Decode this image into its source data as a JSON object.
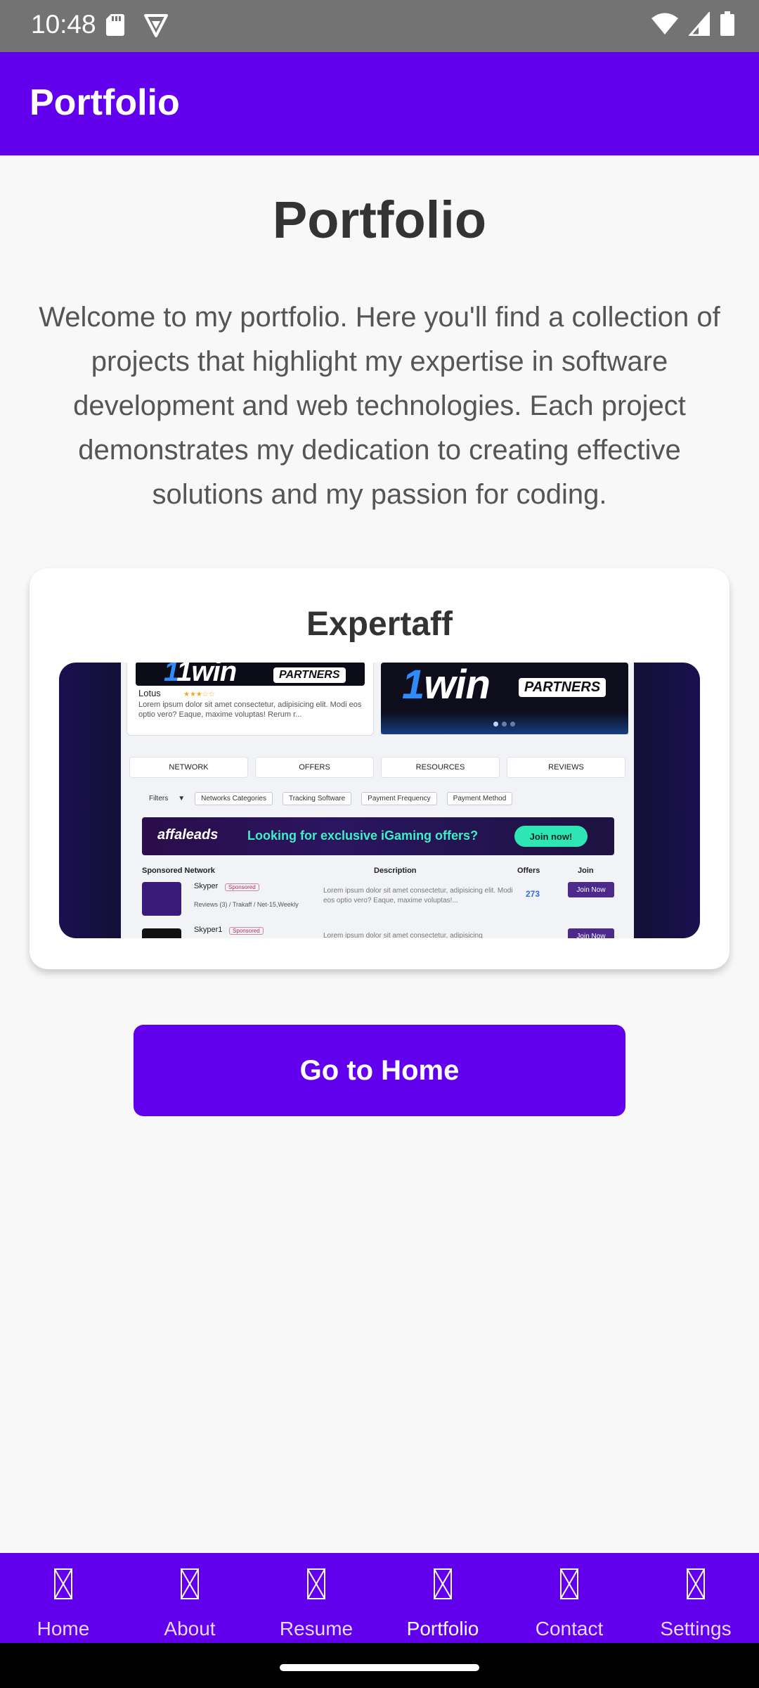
{
  "status_bar": {
    "time": "10:48",
    "icons_left": [
      "sd-card-icon",
      "vpn-shield-icon"
    ],
    "icons_right": [
      "wifi-icon",
      "signal-icon",
      "battery-icon"
    ]
  },
  "app_bar": {
    "title": "Portfolio"
  },
  "main": {
    "title": "Portfolio",
    "intro": "Welcome to my portfolio. Here you'll find a collection of projects that highlight my expertise in software development and web technologies. Each project demonstrates my dedication to creating effective solutions and my passion for coding."
  },
  "project_card": {
    "title": "Expertaff",
    "screenshot": {
      "top_left_name": "Lotus",
      "lorem": "Lorem ipsum dolor sit amet consectetur, adipisicing elit. Modi eos optio vero? Eaque, maxime voluptas! Rerum r...",
      "logo_text": "1win",
      "partners": "PARTNERS",
      "tabs": [
        "NETWORK",
        "OFFERS",
        "RESOURCES",
        "REVIEWS"
      ],
      "filters_label": "Filters",
      "filters": [
        "Networks Categories",
        "Tracking Software",
        "Payment Frequency",
        "Payment Method"
      ],
      "promo_brand": "affaleads",
      "promo_message": "Looking for exclusive iGaming offers?",
      "promo_cta": "Join now!",
      "table_headers": [
        "Sponsored Network",
        "Description",
        "Offers",
        "Join"
      ],
      "rows": [
        {
          "name": "Skyper",
          "badge": "Sponsored",
          "meta": "Reviews (3) / Trakaff / Net-15,Weekly",
          "desc": "Lorem ipsum dolor sit amet consectetur, adipisicing elit. Modi eos optio vero? Eaque, maxime voluptas!...",
          "offers": "273",
          "join": "Join Now"
        },
        {
          "name": "Skyper1",
          "badge": "Sponsored",
          "desc": "Lorem ipsum dolor sit amet consectetur, adipisicing",
          "join": "Join Now"
        }
      ]
    }
  },
  "actions": {
    "go_home": "Go to Home"
  },
  "bottom_nav": {
    "active": "Portfolio",
    "items": [
      {
        "label": "Home"
      },
      {
        "label": "About"
      },
      {
        "label": "Resume"
      },
      {
        "label": "Portfolio"
      },
      {
        "label": "Contact"
      },
      {
        "label": "Settings"
      }
    ]
  },
  "colors": {
    "primary": "#6200ee",
    "status_bar": "#737373",
    "background": "#f8f8f8"
  }
}
